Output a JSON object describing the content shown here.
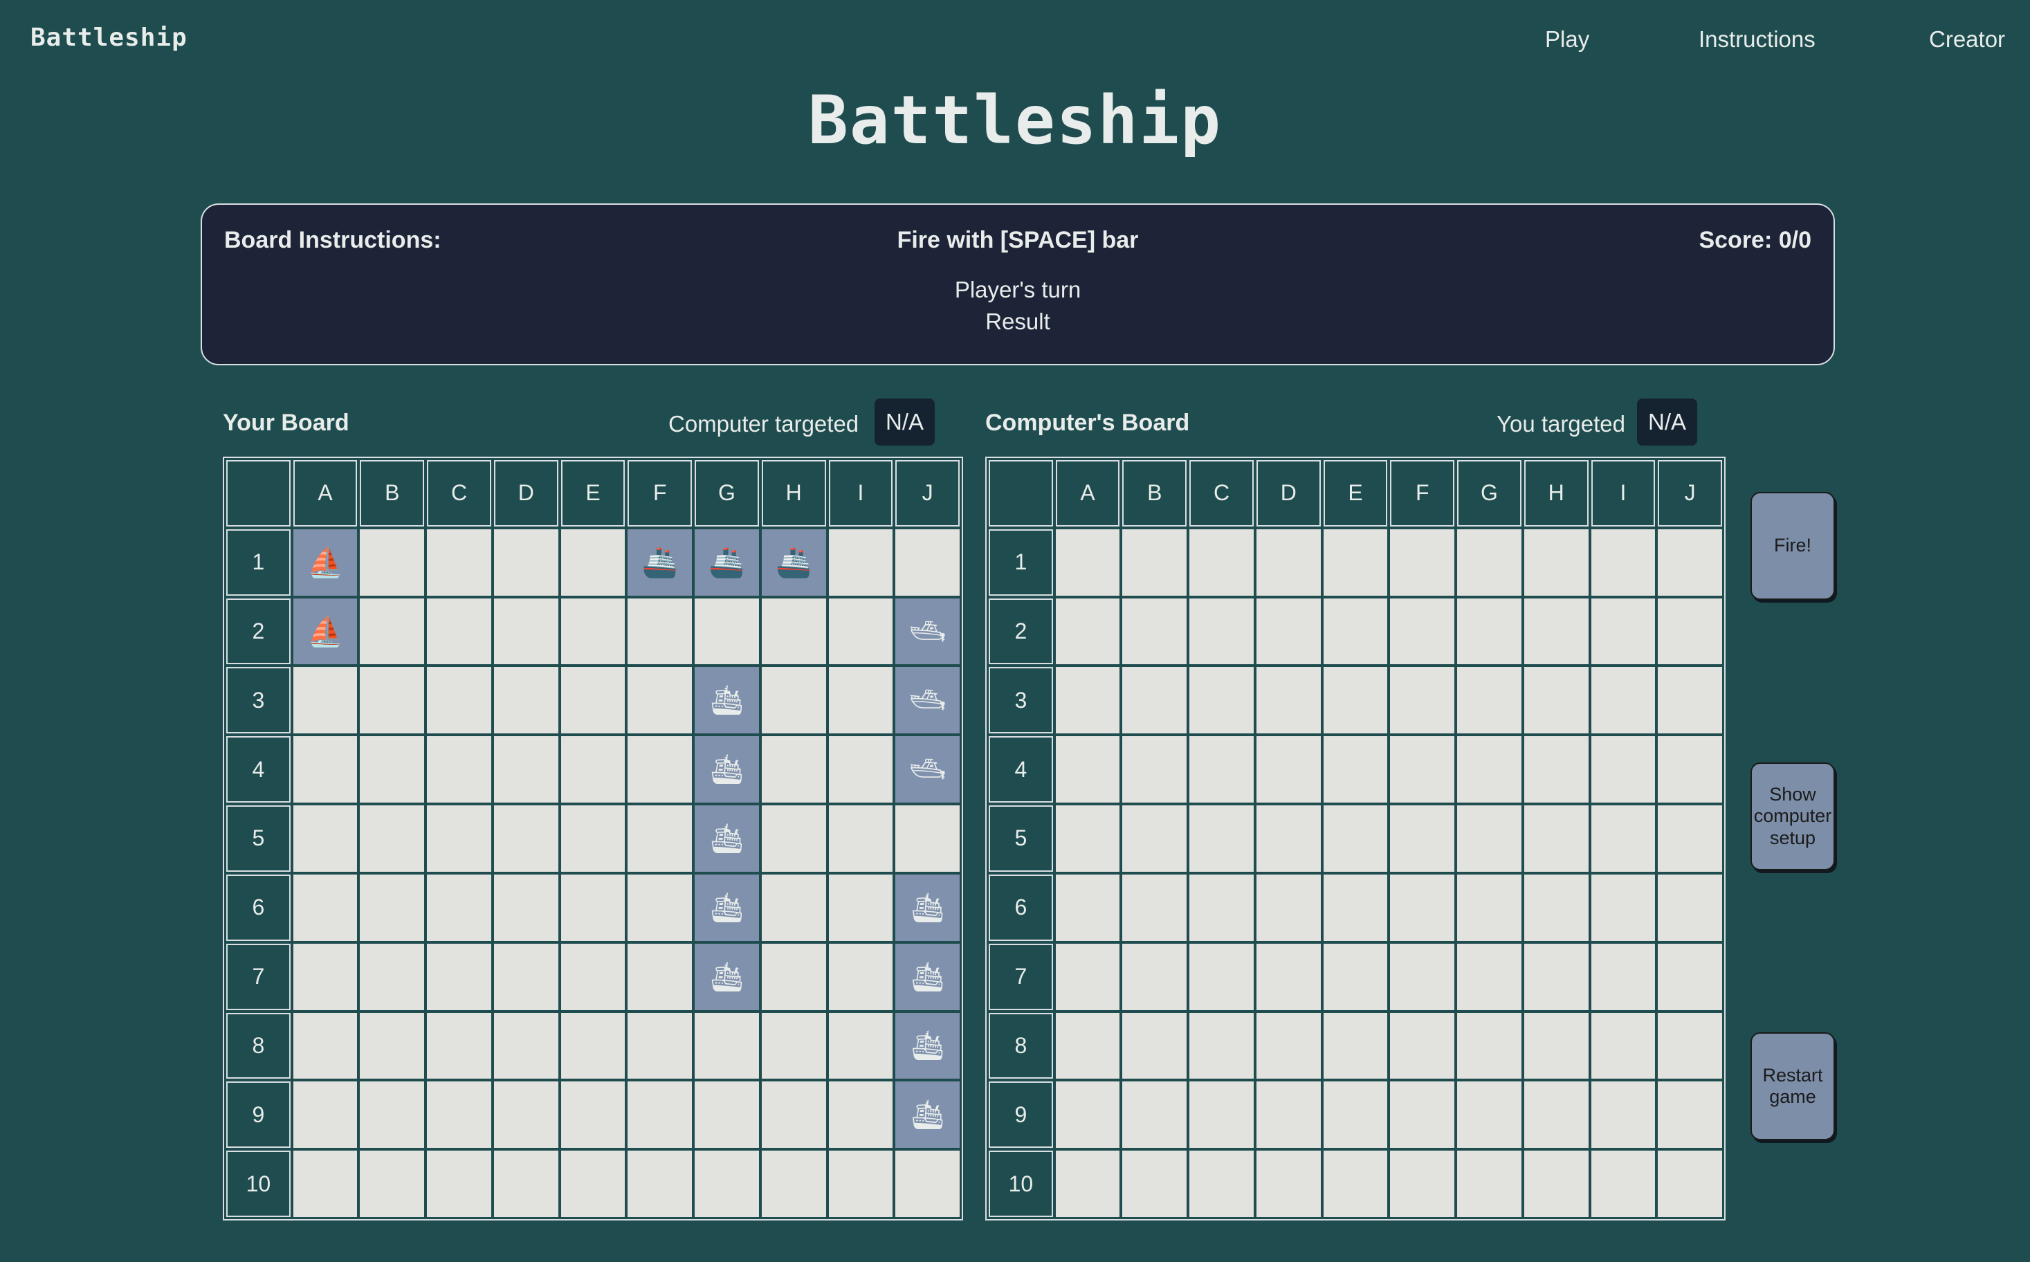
{
  "nav": {
    "brand": "Battleship",
    "links": [
      "Play",
      "Instructions",
      "Creator"
    ]
  },
  "title": "Battleship",
  "panel": {
    "label": "Board Instructions:",
    "fire_hint": "Fire with [SPACE] bar",
    "score": "Score: 0/0",
    "turn": "Player's turn",
    "result": "Result"
  },
  "player_board": {
    "title": "Your Board",
    "target_label": "Computer targeted",
    "target_value": "N/A"
  },
  "computer_board": {
    "title": "Computer's Board",
    "target_label": "You targeted",
    "target_value": "N/A"
  },
  "columns": [
    "A",
    "B",
    "C",
    "D",
    "E",
    "F",
    "G",
    "H",
    "I",
    "J"
  ],
  "rows": [
    "1",
    "2",
    "3",
    "4",
    "5",
    "6",
    "7",
    "8",
    "9",
    "10"
  ],
  "ships": [
    {
      "icon": "sailboat-icon",
      "glyph": "⛵",
      "cells": [
        "A1",
        "A2"
      ]
    },
    {
      "icon": "ship-icon",
      "glyph": "🚢",
      "cells": [
        "F1",
        "G1",
        "H1"
      ]
    },
    {
      "icon": "speedboat-icon",
      "glyph": "🛥",
      "cells": [
        "J2",
        "J3",
        "J4"
      ]
    },
    {
      "icon": "cruise-ship-icon",
      "glyph": "🛳",
      "cells": [
        "G3",
        "G4",
        "G5",
        "G6",
        "G7"
      ]
    },
    {
      "icon": "passenger-ship-icon",
      "glyph": "🛳",
      "cells": [
        "J6",
        "J7",
        "J8",
        "J9"
      ]
    }
  ],
  "buttons": {
    "fire": "Fire!",
    "show_setup": "Show computer setup",
    "restart": "Restart game"
  },
  "colors": {
    "background": "#1f4c4e",
    "panel": "#1d2438",
    "water_cell": "#e2e2de",
    "ship_cell": "#7f91ad",
    "button": "#7d8ea9"
  }
}
